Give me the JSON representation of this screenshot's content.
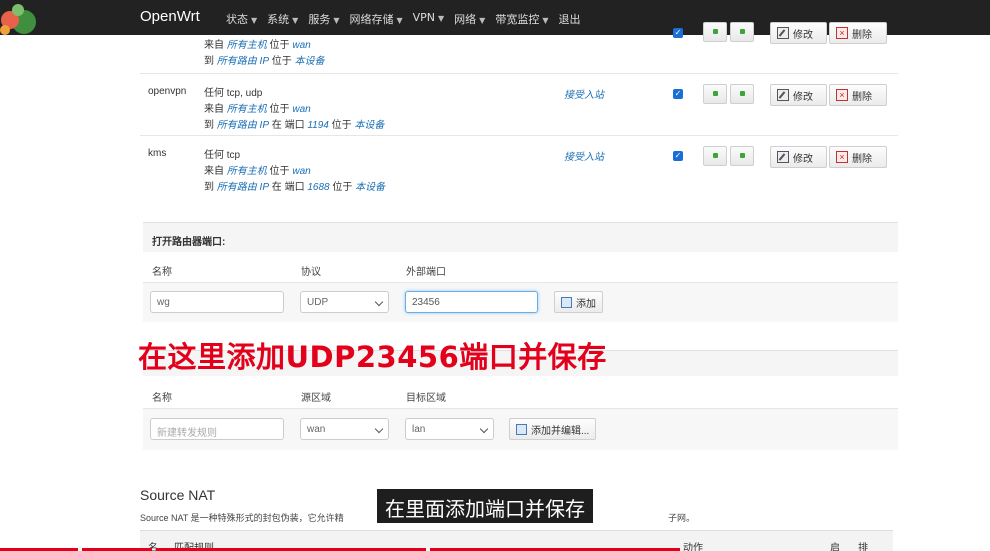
{
  "nav": {
    "brand": "OpenWrt",
    "menu": [
      "状态",
      "系统",
      "服务",
      "网络存储",
      "VPN",
      "网络",
      "带宽监控"
    ],
    "logout": "退出"
  },
  "rules": [
    {
      "name": "",
      "line1": "",
      "line2_prefix": "来自 ",
      "line2_em": "所有主机",
      "line2_mid": " 位于 ",
      "line2_em2": "wan",
      "line3_prefix": "到 ",
      "line3_em": "所有路由 IP",
      "line3_mid": " 位于 ",
      "line3_em2": "本设备",
      "action": "",
      "edit": "修改",
      "delete": "删除"
    },
    {
      "name": "openvpn",
      "line1": "任何 tcp, udp",
      "line2_prefix": "来自 ",
      "line2_em": "所有主机",
      "line2_mid": " 位于 ",
      "line2_em2": "wan",
      "line3_prefix": "到 ",
      "line3_em": "所有路由 IP",
      "line3_mid": " 在 端口 ",
      "line3_port": "1194",
      "line3_mid2": " 位于 ",
      "line3_em2": "本设备",
      "action": "接受入站",
      "edit": "修改",
      "delete": "删除"
    },
    {
      "name": "kms",
      "line1": "任何 tcp",
      "line2_prefix": "来自 ",
      "line2_em": "所有主机",
      "line2_mid": " 位于 ",
      "line2_em2": "wan",
      "line3_prefix": "到 ",
      "line3_em": "所有路由 IP",
      "line3_mid": " 在 端口 ",
      "line3_port": "1688",
      "line3_mid2": " 位于 ",
      "line3_em2": "本设备",
      "action": "接受入站",
      "edit": "修改",
      "delete": "删除"
    }
  ],
  "open_ports": {
    "title": "打开路由器端口:",
    "col_name": "名称",
    "col_proto": "协议",
    "col_ext": "外部端口",
    "name_value": "wg",
    "proto_value": "UDP",
    "ext_value": "23456",
    "add_label": "添加"
  },
  "forward": {
    "col_name": "名称",
    "col_src": "源区域",
    "col_dst": "目标区域",
    "name_placeholder": "新建转发规则",
    "src_value": "wan",
    "dst_value": "lan",
    "add_label": "添加并编辑..."
  },
  "overlay_text": "在这里添加UDP23456端口并保存",
  "subtitle": "在里面添加端口并保存",
  "snat": {
    "title": "Source NAT",
    "desc": "Source NAT 是一种特殊形式的封包伪装，它允许精",
    "desc_tail": "子网。",
    "col_name": "名",
    "col_match": "匹配规则",
    "col_action": "动作",
    "col_enable": "启",
    "col_sort": "排"
  }
}
